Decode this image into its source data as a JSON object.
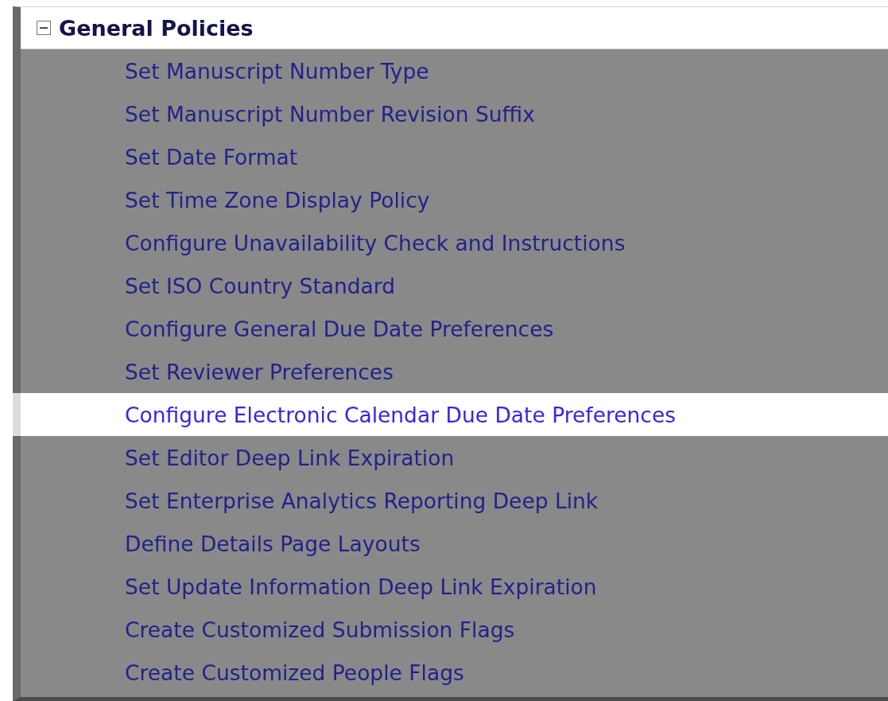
{
  "section": {
    "title": "General Policies",
    "expanded": true,
    "items": [
      {
        "label": "Set Manuscript Number Type",
        "selected": false
      },
      {
        "label": "Set Manuscript Number Revision Suffix",
        "selected": false
      },
      {
        "label": "Set Date Format",
        "selected": false
      },
      {
        "label": "Set Time Zone Display Policy",
        "selected": false
      },
      {
        "label": "Configure Unavailability Check and Instructions",
        "selected": false
      },
      {
        "label": "Set ISO Country Standard",
        "selected": false
      },
      {
        "label": "Configure General Due Date Preferences",
        "selected": false
      },
      {
        "label": "Set Reviewer Preferences",
        "selected": false
      },
      {
        "label": "Configure Electronic Calendar Due Date Preferences",
        "selected": true
      },
      {
        "label": "Set Editor Deep Link Expiration",
        "selected": false
      },
      {
        "label": "Set Enterprise Analytics Reporting Deep Link",
        "selected": false
      },
      {
        "label": "Define Details Page Layouts",
        "selected": false
      },
      {
        "label": "Set Update Information Deep Link Expiration",
        "selected": false
      },
      {
        "label": "Create Customized Submission Flags",
        "selected": false
      },
      {
        "label": "Create Customized People Flags",
        "selected": false
      }
    ]
  }
}
